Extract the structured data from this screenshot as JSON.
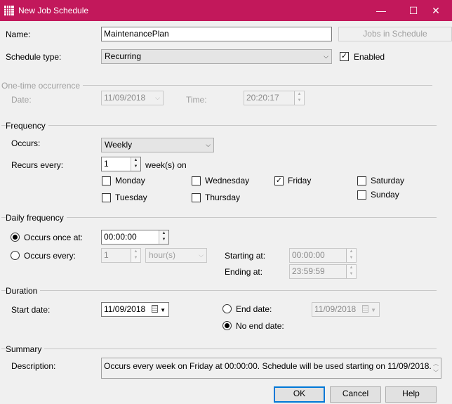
{
  "window": {
    "title": "New Job Schedule",
    "titlebar_color": "#c2185b",
    "minimize_glyph": "—",
    "maximize_glyph": "☐",
    "close_glyph": "✕"
  },
  "general": {
    "name_label": "Name:",
    "name_value": "MaintenancePlan",
    "jobs_button": "Jobs in Schedule",
    "schedule_type_label": "Schedule type:",
    "schedule_type_value": "Recurring",
    "enabled_label": "Enabled",
    "enabled_checked": true
  },
  "one_time": {
    "group_title": "One-time occurrence",
    "date_label": "Date:",
    "date_value": "11/09/2018",
    "time_label": "Time:",
    "time_value": "20:20:17"
  },
  "frequency": {
    "group_title": "Frequency",
    "occurs_label": "Occurs:",
    "occurs_value": "Weekly",
    "recurs_label": "Recurs every:",
    "recurs_value": "1",
    "recurs_suffix": "week(s) on",
    "days": [
      {
        "label": "Monday",
        "checked": false
      },
      {
        "label": "Tuesday",
        "checked": false
      },
      {
        "label": "Wednesday",
        "checked": false
      },
      {
        "label": "Thursday",
        "checked": false
      },
      {
        "label": "Friday",
        "checked": true
      },
      {
        "label": "Saturday",
        "checked": false
      },
      {
        "label": "Sunday",
        "checked": false
      }
    ]
  },
  "daily": {
    "group_title": "Daily frequency",
    "once_label": "Occurs once at:",
    "once_value": "00:00:00",
    "once_selected": true,
    "every_label": "Occurs every:",
    "every_value": "1",
    "every_unit": "hour(s)",
    "starting_label": "Starting at:",
    "starting_value": "00:00:00",
    "ending_label": "Ending at:",
    "ending_value": "23:59:59"
  },
  "duration": {
    "group_title": "Duration",
    "start_label": "Start date:",
    "start_value": "11/09/2018",
    "end_label": "End date:",
    "end_value": "11/09/2018",
    "no_end_label": "No end date:",
    "no_end_selected": true
  },
  "summary": {
    "group_title": "Summary",
    "description_label": "Description:",
    "description_value": "Occurs every week on Friday at 00:00:00. Schedule will be used starting on 11/09/2018."
  },
  "buttons": {
    "ok": "OK",
    "cancel": "Cancel",
    "help": "Help"
  },
  "icons": {
    "app": "calendar-grid-icon",
    "check": "✓",
    "dropdown": "⌵"
  }
}
